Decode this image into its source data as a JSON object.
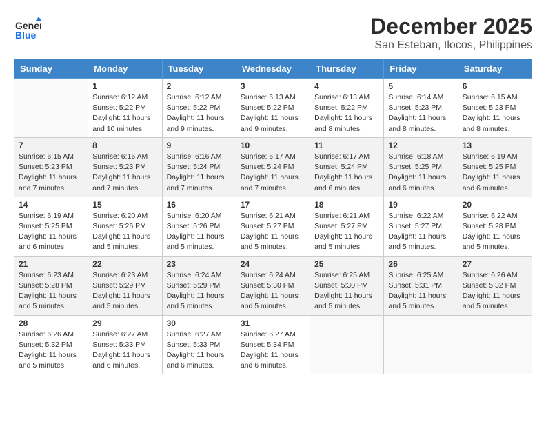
{
  "logo": {
    "line1": "General",
    "line2": "Blue"
  },
  "title": "December 2025",
  "subtitle": "San Esteban, Ilocos, Philippines",
  "weekdays": [
    "Sunday",
    "Monday",
    "Tuesday",
    "Wednesday",
    "Thursday",
    "Friday",
    "Saturday"
  ],
  "weeks": [
    [
      {
        "day": "",
        "empty": true
      },
      {
        "day": "1",
        "sunrise": "6:12 AM",
        "sunset": "5:22 PM",
        "daylight": "11 hours and 10 minutes."
      },
      {
        "day": "2",
        "sunrise": "6:12 AM",
        "sunset": "5:22 PM",
        "daylight": "11 hours and 9 minutes."
      },
      {
        "day": "3",
        "sunrise": "6:13 AM",
        "sunset": "5:22 PM",
        "daylight": "11 hours and 9 minutes."
      },
      {
        "day": "4",
        "sunrise": "6:13 AM",
        "sunset": "5:22 PM",
        "daylight": "11 hours and 8 minutes."
      },
      {
        "day": "5",
        "sunrise": "6:14 AM",
        "sunset": "5:23 PM",
        "daylight": "11 hours and 8 minutes."
      },
      {
        "day": "6",
        "sunrise": "6:15 AM",
        "sunset": "5:23 PM",
        "daylight": "11 hours and 8 minutes."
      }
    ],
    [
      {
        "day": "7",
        "sunrise": "6:15 AM",
        "sunset": "5:23 PM",
        "daylight": "11 hours and 7 minutes."
      },
      {
        "day": "8",
        "sunrise": "6:16 AM",
        "sunset": "5:23 PM",
        "daylight": "11 hours and 7 minutes."
      },
      {
        "day": "9",
        "sunrise": "6:16 AM",
        "sunset": "5:24 PM",
        "daylight": "11 hours and 7 minutes."
      },
      {
        "day": "10",
        "sunrise": "6:17 AM",
        "sunset": "5:24 PM",
        "daylight": "11 hours and 7 minutes."
      },
      {
        "day": "11",
        "sunrise": "6:17 AM",
        "sunset": "5:24 PM",
        "daylight": "11 hours and 6 minutes."
      },
      {
        "day": "12",
        "sunrise": "6:18 AM",
        "sunset": "5:25 PM",
        "daylight": "11 hours and 6 minutes."
      },
      {
        "day": "13",
        "sunrise": "6:19 AM",
        "sunset": "5:25 PM",
        "daylight": "11 hours and 6 minutes."
      }
    ],
    [
      {
        "day": "14",
        "sunrise": "6:19 AM",
        "sunset": "5:25 PM",
        "daylight": "11 hours and 6 minutes."
      },
      {
        "day": "15",
        "sunrise": "6:20 AM",
        "sunset": "5:26 PM",
        "daylight": "11 hours and 5 minutes."
      },
      {
        "day": "16",
        "sunrise": "6:20 AM",
        "sunset": "5:26 PM",
        "daylight": "11 hours and 5 minutes."
      },
      {
        "day": "17",
        "sunrise": "6:21 AM",
        "sunset": "5:27 PM",
        "daylight": "11 hours and 5 minutes."
      },
      {
        "day": "18",
        "sunrise": "6:21 AM",
        "sunset": "5:27 PM",
        "daylight": "11 hours and 5 minutes."
      },
      {
        "day": "19",
        "sunrise": "6:22 AM",
        "sunset": "5:27 PM",
        "daylight": "11 hours and 5 minutes."
      },
      {
        "day": "20",
        "sunrise": "6:22 AM",
        "sunset": "5:28 PM",
        "daylight": "11 hours and 5 minutes."
      }
    ],
    [
      {
        "day": "21",
        "sunrise": "6:23 AM",
        "sunset": "5:28 PM",
        "daylight": "11 hours and 5 minutes."
      },
      {
        "day": "22",
        "sunrise": "6:23 AM",
        "sunset": "5:29 PM",
        "daylight": "11 hours and 5 minutes."
      },
      {
        "day": "23",
        "sunrise": "6:24 AM",
        "sunset": "5:29 PM",
        "daylight": "11 hours and 5 minutes."
      },
      {
        "day": "24",
        "sunrise": "6:24 AM",
        "sunset": "5:30 PM",
        "daylight": "11 hours and 5 minutes."
      },
      {
        "day": "25",
        "sunrise": "6:25 AM",
        "sunset": "5:30 PM",
        "daylight": "11 hours and 5 minutes."
      },
      {
        "day": "26",
        "sunrise": "6:25 AM",
        "sunset": "5:31 PM",
        "daylight": "11 hours and 5 minutes."
      },
      {
        "day": "27",
        "sunrise": "6:26 AM",
        "sunset": "5:32 PM",
        "daylight": "11 hours and 5 minutes."
      }
    ],
    [
      {
        "day": "28",
        "sunrise": "6:26 AM",
        "sunset": "5:32 PM",
        "daylight": "11 hours and 5 minutes."
      },
      {
        "day": "29",
        "sunrise": "6:27 AM",
        "sunset": "5:33 PM",
        "daylight": "11 hours and 6 minutes."
      },
      {
        "day": "30",
        "sunrise": "6:27 AM",
        "sunset": "5:33 PM",
        "daylight": "11 hours and 6 minutes."
      },
      {
        "day": "31",
        "sunrise": "6:27 AM",
        "sunset": "5:34 PM",
        "daylight": "11 hours and 6 minutes."
      },
      {
        "day": "",
        "empty": true
      },
      {
        "day": "",
        "empty": true
      },
      {
        "day": "",
        "empty": true
      }
    ]
  ]
}
